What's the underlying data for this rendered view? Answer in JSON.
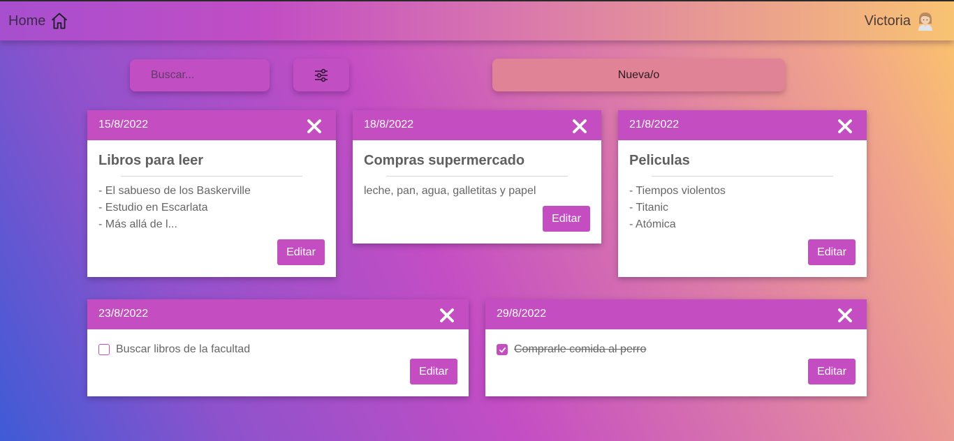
{
  "header": {
    "home_label": "Home",
    "user_name": "Victoria"
  },
  "toolbar": {
    "search_placeholder": "Buscar...",
    "new_label": "Nueva/o"
  },
  "notes": [
    {
      "date": "15/8/2022",
      "title": "Libros para leer",
      "lines": [
        "- El sabueso de los Baskerville",
        "- Estudio en Escarlata",
        "- Más allá de l..."
      ],
      "edit_label": "Editar"
    },
    {
      "date": "18/8/2022",
      "title": "Compras supermercado",
      "lines": [
        "leche, pan, agua, galletitas y papel"
      ],
      "edit_label": "Editar"
    },
    {
      "date": "21/8/2022",
      "title": "Peliculas",
      "lines": [
        "- Tiempos violentos",
        "- Titanic",
        "- Atómica"
      ],
      "edit_label": "Editar"
    },
    {
      "date": "23/8/2022",
      "task": "Buscar libros de la facultad",
      "checked": false,
      "edit_label": "Editar"
    },
    {
      "date": "29/8/2022",
      "task": "Comprarle comida al perro",
      "checked": true,
      "edit_label": "Editar"
    }
  ],
  "icons": {
    "home": "home-icon",
    "avatar": "avatar-icon",
    "filter": "sliders-icon",
    "close": "close-icon"
  },
  "colors": {
    "accent": "#c34dc1",
    "new_button": "#e08396"
  }
}
